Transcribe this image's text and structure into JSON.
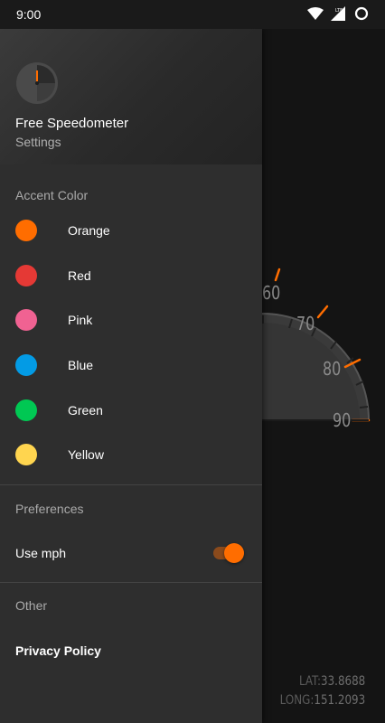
{
  "status_bar": {
    "time": "9:00",
    "network_label": "LTE",
    "icons": [
      "wifi-icon",
      "cellular-lte-icon",
      "battery-ring-icon"
    ]
  },
  "drawer": {
    "header": {
      "app_name": "Free Speedometer",
      "subtitle": "Settings",
      "logo_icon": "speedometer-logo-icon"
    },
    "accent_section": {
      "title": "Accent Color",
      "colors": [
        {
          "label": "Orange",
          "hex": "#ff6d00"
        },
        {
          "label": "Red",
          "hex": "#e53935"
        },
        {
          "label": "Pink",
          "hex": "#f06292"
        },
        {
          "label": "Blue",
          "hex": "#039be5"
        },
        {
          "label": "Green",
          "hex": "#00c853"
        },
        {
          "label": "Yellow",
          "hex": "#ffd54f"
        }
      ]
    },
    "preferences_section": {
      "title": "Preferences",
      "use_mph_label": "Use mph",
      "use_mph_enabled": true
    },
    "other_section": {
      "title": "Other",
      "privacy_label": "Privacy Policy"
    }
  },
  "speedometer": {
    "visible_labels": [
      "60",
      "70",
      "80",
      "90"
    ],
    "accent_color": "#ff6d00",
    "coordinates": {
      "lat_label": "LAT:",
      "lat_value": "33.8688",
      "long_label": "LONG:",
      "long_value": "151.2093"
    }
  },
  "theme": {
    "drawer_background": "#2e2e2e",
    "app_background": "#141414",
    "accent": "#ff6d00"
  }
}
